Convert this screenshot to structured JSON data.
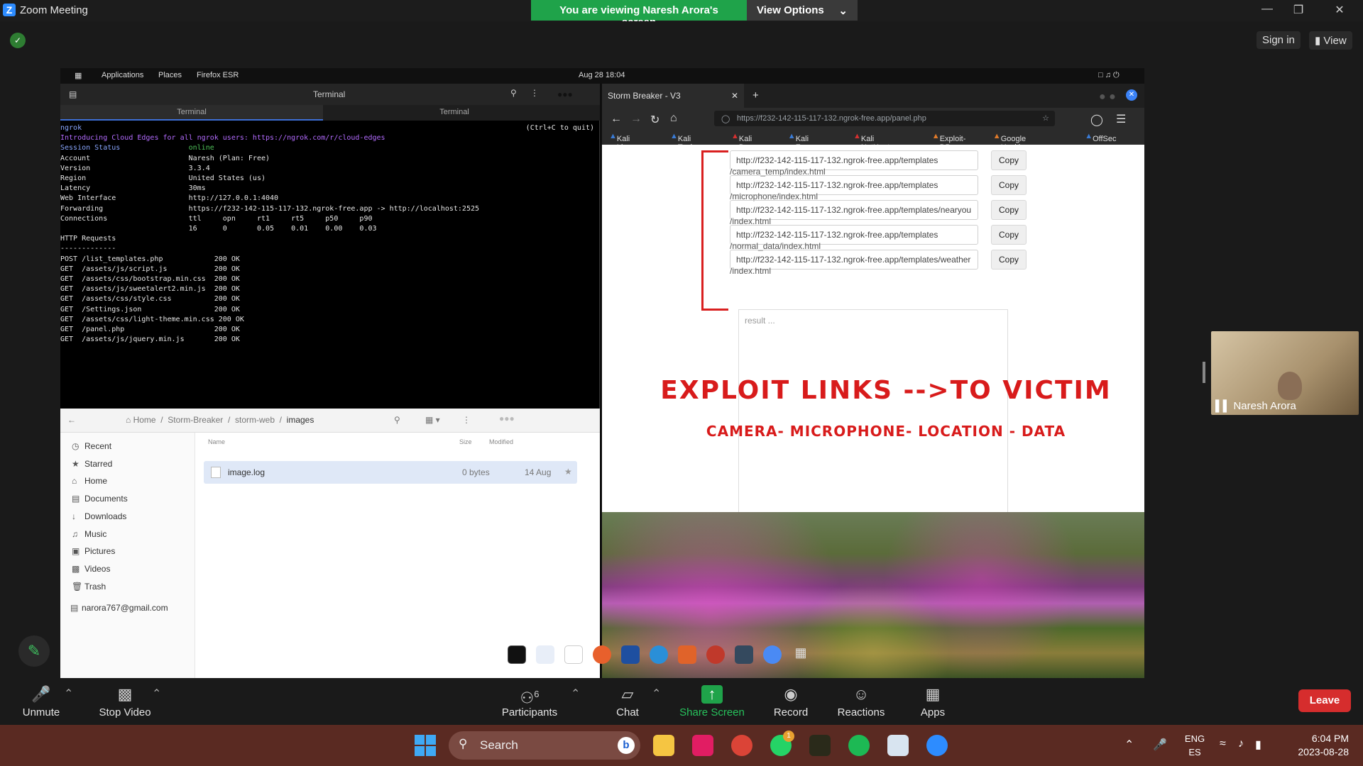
{
  "zoom": {
    "title": "Zoom Meeting",
    "viewing_banner": "You are viewing Naresh Arora's screen",
    "view_options": "View Options",
    "sign_in": "Sign in",
    "view": "View",
    "participant_name": "Naresh Arora",
    "toolbar": {
      "unmute": "Unmute",
      "stop_video": "Stop Video",
      "participants": "Participants",
      "participants_count": "6",
      "chat": "Chat",
      "share_screen": "Share Screen",
      "record": "Record",
      "reactions": "Reactions",
      "apps": "Apps",
      "leave": "Leave"
    },
    "accent_green": "#1fa34a",
    "leave_color": "#d62d2d"
  },
  "kali": {
    "menu_applications": "Applications",
    "menu_places": "Places",
    "menu_firefox": "Firefox ESR",
    "datetime": "Aug 28  18:04"
  },
  "terminal": {
    "title": "Terminal",
    "tabs": [
      "Terminal",
      "Terminal"
    ],
    "lines": [
      {
        "l": "ngrok",
        "r": "(Ctrl+C to quit)",
        "c": "tl"
      },
      {
        "l": "",
        "c": ""
      },
      {
        "l": "Introducing Cloud Edges for all ngrok users: https://ngrok.com/r/cloud-edges",
        "c": "tk"
      },
      {
        "l": "",
        "c": ""
      },
      {
        "l": "Session Status                online",
        "c": "sess"
      },
      {
        "l": "Account                       Naresh (Plan: Free)",
        "c": ""
      },
      {
        "l": "Version                       3.3.4",
        "c": ""
      },
      {
        "l": "Region                        United States (us)",
        "c": ""
      },
      {
        "l": "Latency                       30ms",
        "c": ""
      },
      {
        "l": "Web Interface                 http://127.0.0.1:4040",
        "c": ""
      },
      {
        "l": "Forwarding                    https://f232-142-115-117-132.ngrok-free.app -> http://localhost:2525",
        "c": ""
      },
      {
        "l": "",
        "c": ""
      },
      {
        "l": "Connections                   ttl     opn     rt1     rt5     p50     p90",
        "c": ""
      },
      {
        "l": "                              16      0       0.05    0.01    0.00    0.03",
        "c": ""
      },
      {
        "l": "",
        "c": ""
      },
      {
        "l": "HTTP Requests",
        "c": ""
      },
      {
        "l": "-------------",
        "c": ""
      },
      {
        "l": "",
        "c": ""
      },
      {
        "l": "POST /list_templates.php            200 OK",
        "c": ""
      },
      {
        "l": "GET  /assets/js/script.js           200 OK",
        "c": ""
      },
      {
        "l": "GET  /assets/css/bootstrap.min.css  200 OK",
        "c": ""
      },
      {
        "l": "GET  /assets/js/sweetalert2.min.js  200 OK",
        "c": ""
      },
      {
        "l": "GET  /assets/css/style.css          200 OK",
        "c": ""
      },
      {
        "l": "GET  /Settings.json                 200 OK",
        "c": ""
      },
      {
        "l": "GET  /assets/css/light-theme.min.css 200 OK",
        "c": ""
      },
      {
        "l": "GET  /panel.php                     200 OK",
        "c": ""
      },
      {
        "l": "GET  /assets/js/jquery.min.js       200 OK",
        "c": ""
      }
    ]
  },
  "files": {
    "breadcrumb": [
      "Home",
      "Storm-Breaker",
      "storm-web",
      "images"
    ],
    "sidebar": [
      "Recent",
      "Starred",
      "Home",
      "Documents",
      "Downloads",
      "Music",
      "Pictures",
      "Videos",
      "Trash"
    ],
    "account": "narora767@gmail.com",
    "col_name": "Name",
    "col_size": "Size",
    "col_modified": "Modified",
    "file": {
      "name": "image.log",
      "size": "0 bytes",
      "modified": "14 Aug"
    }
  },
  "firefox": {
    "tab_title": "Storm Breaker - V3",
    "url": "https://f232-142-115-117-132.ngrok-free.app/panel.php",
    "bookmarks": [
      "Kali Linux",
      "Kali Tools",
      "Kali Docs",
      "Kali Forums",
      "Kali NetHunter",
      "Exploit-DB",
      "Google Hacking DB",
      "OffSec"
    ],
    "links": [
      {
        "url": "http://f232-142-115-117-132.ngrok-free.app/templates",
        "rest": "/camera_temp/index.html"
      },
      {
        "url": "http://f232-142-115-117-132.ngrok-free.app/templates",
        "rest": "/microphone/index.html"
      },
      {
        "url": "http://f232-142-115-117-132.ngrok-free.app/templates/nearyou",
        "rest": "/index.html"
      },
      {
        "url": "http://f232-142-115-117-132.ngrok-free.app/templates",
        "rest": "/normal_data/index.html"
      },
      {
        "url": "http://f232-142-115-117-132.ngrok-free.app/templates/weather",
        "rest": "/index.html"
      }
    ],
    "copy_label": "Copy",
    "result_placeholder": "result ...",
    "overlay_title": "EXPLOIT LINKS -->TO VICTIM",
    "overlay_sub": "CAMERA- MICROPHONE- LOCATION - DATA",
    "overlay_color": "#d81b1b"
  },
  "taskbar": {
    "search": "Search",
    "lang1": "ENG",
    "lang2": "ES",
    "time": "6:04 PM",
    "date": "2023-08-28",
    "whatsapp_badge": "1"
  }
}
